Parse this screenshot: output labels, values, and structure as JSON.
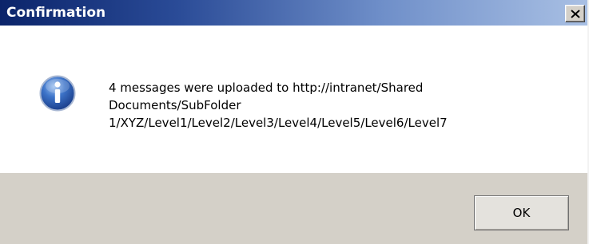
{
  "window": {
    "title": "Confirmation",
    "close_icon": "close-x-icon"
  },
  "message": {
    "icon": "information-icon",
    "line1": "4 messages were uploaded to http://intranet/Shared",
    "line2": "Documents/SubFolder",
    "line3": "1/XYZ/Level1/Level2/Level3/Level4/Level5/Level6/Level7"
  },
  "buttons": {
    "ok_label": "OK"
  },
  "colors": {
    "title_gradient_start": "#0b246a",
    "title_gradient_end": "#a9c0e4",
    "content_bg": "#ffffff",
    "footer_bg": "#d4d0c8",
    "info_icon_blue": "#2f5fb3"
  }
}
